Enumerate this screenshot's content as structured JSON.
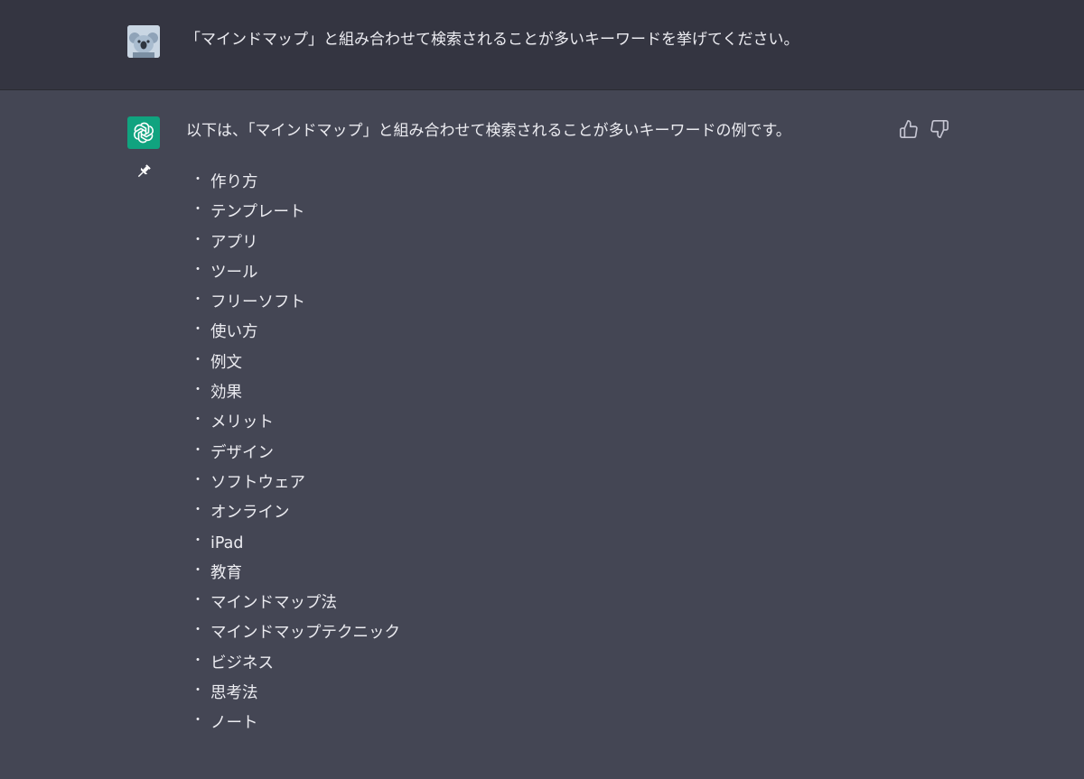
{
  "user_message": {
    "avatar": "user-avatar",
    "text": "「マインドマップ」と組み合わせて検索されることが多いキーワードを挙げてください。"
  },
  "assistant_message": {
    "avatar": "openai-logo-icon",
    "intro": "以下は、「マインドマップ」と組み合わせて検索されることが多いキーワードの例です。",
    "bullet": "・",
    "keywords": [
      "作り方",
      "テンプレート",
      "アプリ",
      "ツール",
      "フリーソフト",
      "使い方",
      "例文",
      "効果",
      "メリット",
      "デザイン",
      "ソフトウェア",
      "オンライン",
      "iPad",
      "教育",
      "マインドマップ法",
      "マインドマップテクニック",
      "ビジネス",
      "思考法",
      "ノート"
    ],
    "actions": [
      "thumbs-up-icon",
      "thumbs-down-icon"
    ]
  },
  "colors": {
    "user_bg": "#343541",
    "assistant_bg": "#444654",
    "bot_avatar": "#10a37f",
    "text": "#ececf1"
  }
}
